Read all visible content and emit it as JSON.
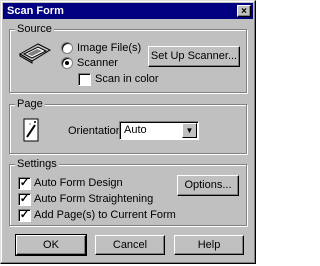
{
  "window": {
    "title": "Scan Form",
    "close_glyph": "×"
  },
  "source": {
    "group_label": "Source",
    "image_files_label": "Image File(s)",
    "scanner_label": "Scanner",
    "scanner_selected": true,
    "scan_in_color_label": "Scan in color",
    "scan_in_color_checked": false,
    "setup_scanner_label": "Set Up Scanner..."
  },
  "page": {
    "group_label": "Page",
    "orientation_label": "Orientation:",
    "orientation_value": "Auto"
  },
  "settings": {
    "group_label": "Settings",
    "auto_form_design_label": "Auto Form Design",
    "auto_form_design_checked": true,
    "auto_form_straightening_label": "Auto Form Straightening",
    "auto_form_straightening_checked": true,
    "add_pages_label": "Add Page(s) to Current Form",
    "add_pages_checked": true,
    "options_label": "Options...",
    "check_glyph": "✓"
  },
  "buttons": {
    "ok": "OK",
    "cancel": "Cancel",
    "help": "Help"
  },
  "icons": {
    "scanner": "scanner-icon",
    "magic_wand": "magic-wand-icon",
    "dropdown": "chevron-down-icon"
  }
}
